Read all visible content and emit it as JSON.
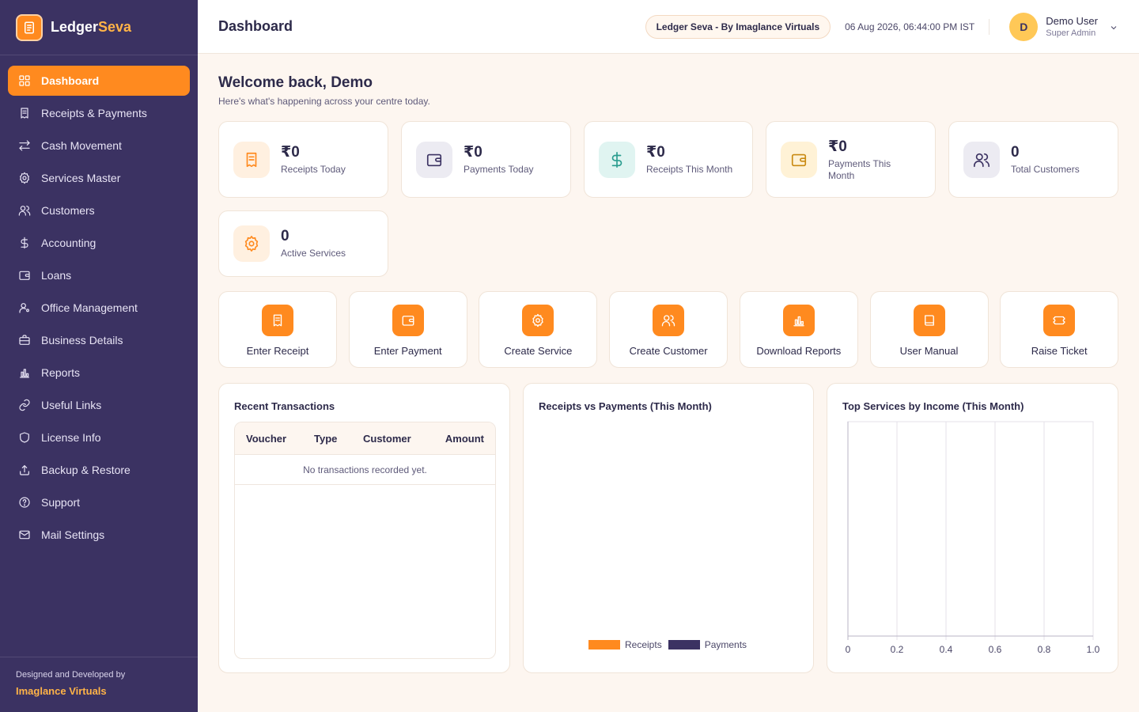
{
  "brand": {
    "name_part1": "Ledger",
    "name_part2": "Seva"
  },
  "sidebar": {
    "items": [
      {
        "label": "Dashboard",
        "icon": "grid-icon",
        "active": true
      },
      {
        "label": "Receipts & Payments",
        "icon": "receipt-icon"
      },
      {
        "label": "Cash Movement",
        "icon": "swap-icon"
      },
      {
        "label": "Services Master",
        "icon": "gear-icon"
      },
      {
        "label": "Customers",
        "icon": "users-icon"
      },
      {
        "label": "Accounting",
        "icon": "dollar-icon"
      },
      {
        "label": "Loans",
        "icon": "wallet-icon"
      },
      {
        "label": "Office Management",
        "icon": "user-cog-icon"
      },
      {
        "label": "Business Details",
        "icon": "briefcase-icon"
      },
      {
        "label": "Reports",
        "icon": "bar-chart-icon"
      },
      {
        "label": "Useful Links",
        "icon": "link-icon"
      },
      {
        "label": "License Info",
        "icon": "shield-icon"
      },
      {
        "label": "Backup & Restore",
        "icon": "upload-icon"
      },
      {
        "label": "Support",
        "icon": "support-icon"
      },
      {
        "label": "Mail Settings",
        "icon": "mail-icon"
      }
    ],
    "footer_small": "Designed and Developed by",
    "footer_company": "Imaglance Virtuals"
  },
  "header": {
    "title": "Dashboard",
    "pill": "Ledger Seva - By Imaglance Virtuals",
    "datetime": "06 Aug 2026, 06:44:00 PM IST",
    "user_initial": "D",
    "user_name": "Demo User",
    "user_role": "Super Admin"
  },
  "welcome": {
    "title": "Welcome back, Demo",
    "subtitle": "Here's what's happening across your centre today."
  },
  "stats": [
    {
      "value": "₹0",
      "label": "Receipts Today",
      "icon": "receipt-icon",
      "icon_color": "#ff8a1f",
      "icon_bg": "#fff0e0"
    },
    {
      "value": "₹0",
      "label": "Payments Today",
      "icon": "wallet-icon",
      "icon_color": "#3b3262",
      "icon_bg": "#ecebf2"
    },
    {
      "value": "₹0",
      "label": "Receipts This Month",
      "icon": "dollar-icon",
      "icon_color": "#2a9d8f",
      "icon_bg": "#e0f4f1"
    },
    {
      "value": "₹0",
      "label": "Payments This Month",
      "icon": "wallet-icon",
      "icon_color": "#c98a12",
      "icon_bg": "#fff2d6"
    },
    {
      "value": "0",
      "label": "Total Customers",
      "icon": "users-icon",
      "icon_color": "#3b3262",
      "icon_bg": "#ecebf2"
    },
    {
      "value": "0",
      "label": "Active Services",
      "icon": "gear-icon",
      "icon_color": "#ff8a1f",
      "icon_bg": "#fff0e0"
    }
  ],
  "actions": [
    {
      "label": "Enter Receipt",
      "icon": "receipt-icon"
    },
    {
      "label": "Enter Payment",
      "icon": "wallet-icon"
    },
    {
      "label": "Create Service",
      "icon": "gear-icon"
    },
    {
      "label": "Create Customer",
      "icon": "users-icon"
    },
    {
      "label": "Download Reports",
      "icon": "bar-chart-icon"
    },
    {
      "label": "User Manual",
      "icon": "book-icon"
    },
    {
      "label": "Raise Ticket",
      "icon": "ticket-icon"
    }
  ],
  "recent_transactions": {
    "title": "Recent Transactions",
    "columns": [
      "Voucher",
      "Type",
      "Customer",
      "Amount"
    ],
    "empty_text": "No transactions recorded yet."
  },
  "chart_data": [
    {
      "type": "bar",
      "title": "Receipts vs Payments (This Month)",
      "series": [
        {
          "name": "Receipts",
          "values": [],
          "color": "#ff8a1f"
        },
        {
          "name": "Payments",
          "values": [],
          "color": "#3b3262"
        }
      ]
    },
    {
      "type": "bar",
      "title": "Top Services by Income (This Month)",
      "orientation": "horizontal",
      "categories": [],
      "values": [],
      "xlim": [
        0,
        1.0
      ],
      "xticks": [
        "0",
        "0.2",
        "0.4",
        "0.6",
        "0.8",
        "1.0"
      ],
      "grid": true
    }
  ],
  "colors": {
    "accent": "#ff8a1f",
    "sidebar": "#3b3262",
    "highlight": "#ffb347"
  }
}
